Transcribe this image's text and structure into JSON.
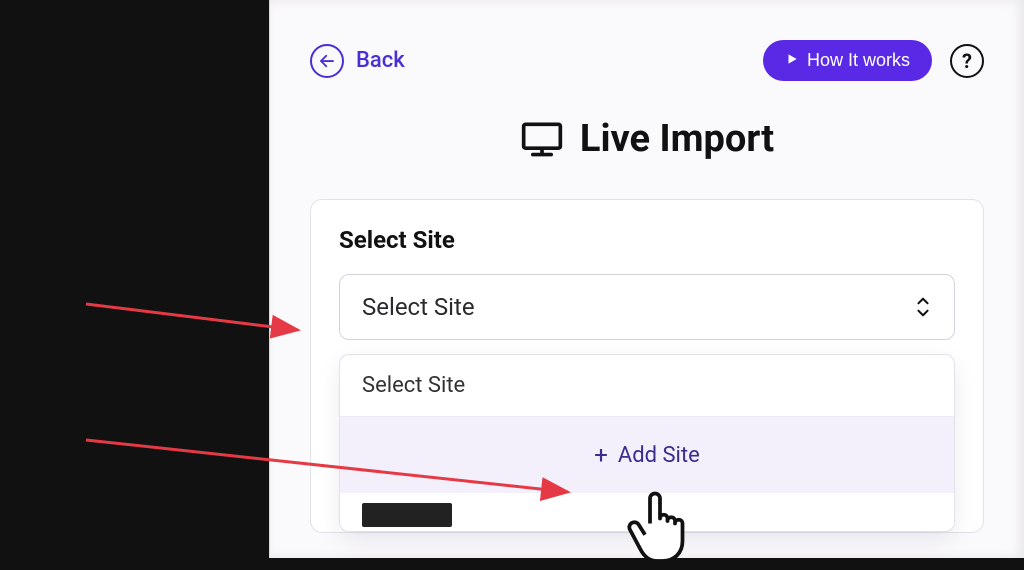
{
  "topbar": {
    "back_label": "Back",
    "how_it_works_label": "How It works",
    "help_symbol": "?"
  },
  "page": {
    "title": "Live Import"
  },
  "form": {
    "select_site_label": "Select Site",
    "select_site_value": "Select Site"
  },
  "dropdown": {
    "heading": "Select Site",
    "add_site_label": "Add Site"
  }
}
